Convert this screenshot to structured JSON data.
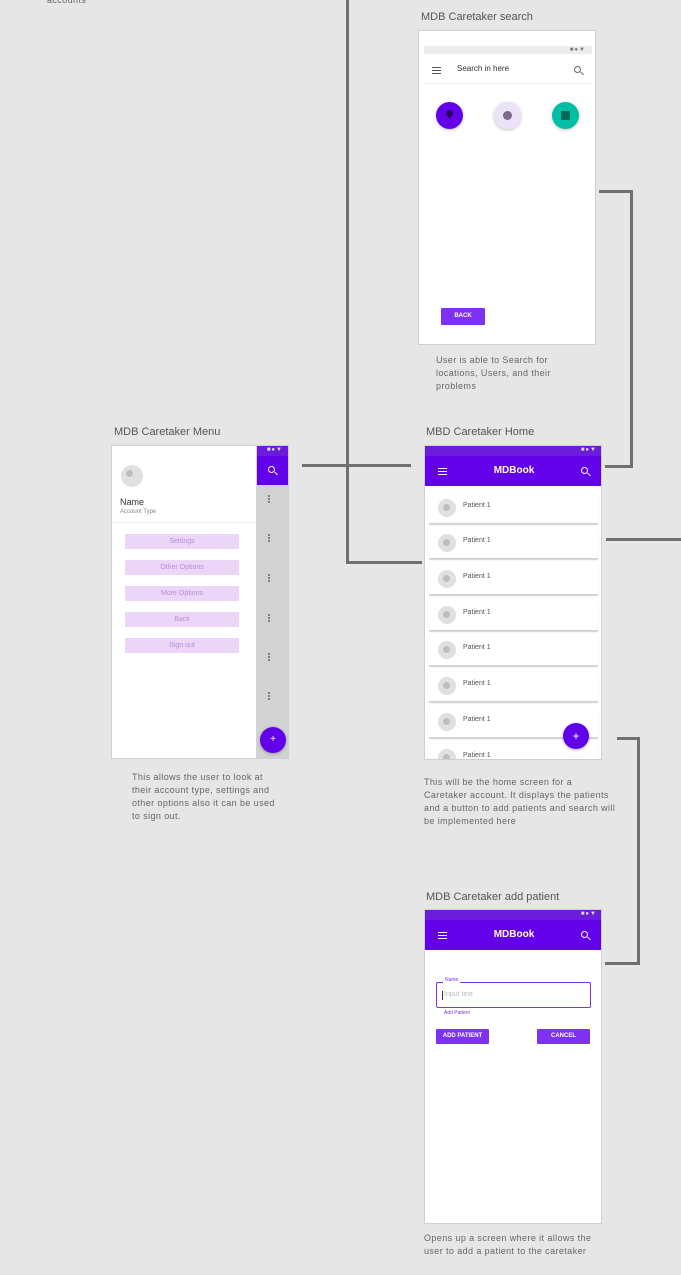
{
  "partial_text": "accounts",
  "search_screen": {
    "title": "MDB Caretaker search",
    "search_placeholder": "Search in here",
    "back_label": "BACK",
    "description": "User is able to Search for locations, Users, and their problems",
    "icons": [
      {
        "name": "location",
        "color": "#6200ea"
      },
      {
        "name": "user",
        "color": "#ede3f8"
      },
      {
        "name": "problems",
        "color": "#00bfa5"
      }
    ]
  },
  "menu_screen": {
    "title": "MDB Caretaker Menu",
    "user_name": "Name",
    "account_type": "Account Type",
    "menu_items": [
      "Settings",
      "Other Options",
      "More Options",
      "Back",
      "Sign out"
    ],
    "fab_label": "+",
    "description": "This allows the user to look at their account type, settings and other options also it can be used to sign out."
  },
  "home_screen": {
    "title": "MBD Caretaker Home",
    "app_title": "MDBook",
    "patients": [
      "Patient 1",
      "Patient 1",
      "Patient 1",
      "Patient 1",
      "Patient 1",
      "Patient 1",
      "Patient 1",
      "Patient 1"
    ],
    "fab_label": "+",
    "description": "This will be the home screen for a Caretaker account. It displays the patients and a button to add patients and search will be implemented here"
  },
  "add_patient_screen": {
    "title": "MDB Caretaker add patient",
    "app_title": "MDBook",
    "field_label": "Name",
    "field_placeholder": "Input text",
    "helper_text": "Add Patient",
    "add_button_label": "ADD PATIENT",
    "cancel_button_label": "CANCEL",
    "description": "Opens up a screen where it allows the user to add a patient to the caretaker"
  },
  "colors": {
    "primary": "#6200ea",
    "status_bar": "#6a1cd8",
    "menu_button_bg": "#ecd6f8",
    "connector": "#6f6f6f",
    "canvas": "#e6e6e6"
  }
}
